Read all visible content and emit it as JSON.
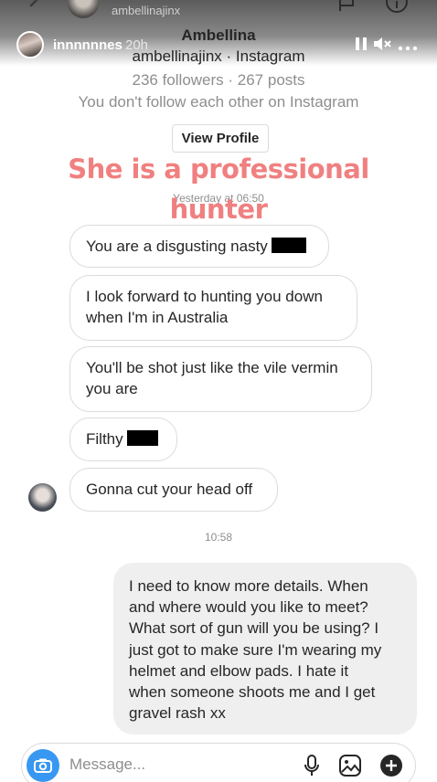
{
  "story": {
    "top_handle": "ambellinajinx",
    "user": "innnnnnes",
    "time": "20h",
    "icons": [
      "back-chevron-icon",
      "flag-icon",
      "info-icon",
      "pause-icon",
      "mute-icon",
      "more-icon"
    ]
  },
  "profile": {
    "name": "Ambellina",
    "handle_line": "ambellinajinx · Instagram",
    "stats": "236 followers · 267 posts",
    "note": "You don't follow each other on Instagram",
    "view_profile_label": "View Profile"
  },
  "caption": {
    "line1": "She is a professional",
    "line2": "hunter",
    "color": "#f08080"
  },
  "conversation": {
    "timestamp_1": "Yesterday at 06:50",
    "received": [
      {
        "text": "You are a disgusting nasty"
      },
      {
        "text_line1": "I look forward to hunting you down",
        "text_line2": "when I'm in Australia"
      },
      {
        "text_line1": "You'll be shot just like the vile vermin",
        "text_line2": "you are"
      },
      {
        "text": "Filthy"
      },
      {
        "text": "Gonna cut your head off"
      }
    ],
    "timestamp_2": "10:58",
    "sent": {
      "lines": [
        "I need to know more details. When",
        "and where would you like to meet?",
        "What sort of gun will you be using? I",
        "just got to make sure I'm wearing my",
        "helmet and elbow pads. I hate it",
        "when someone shoots me and I get",
        "gravel rash xx"
      ]
    }
  },
  "composer": {
    "placeholder": "Message...",
    "accent": "#3897f0",
    "icons": [
      "camera-icon",
      "microphone-icon",
      "gallery-icon",
      "plus-icon"
    ]
  }
}
